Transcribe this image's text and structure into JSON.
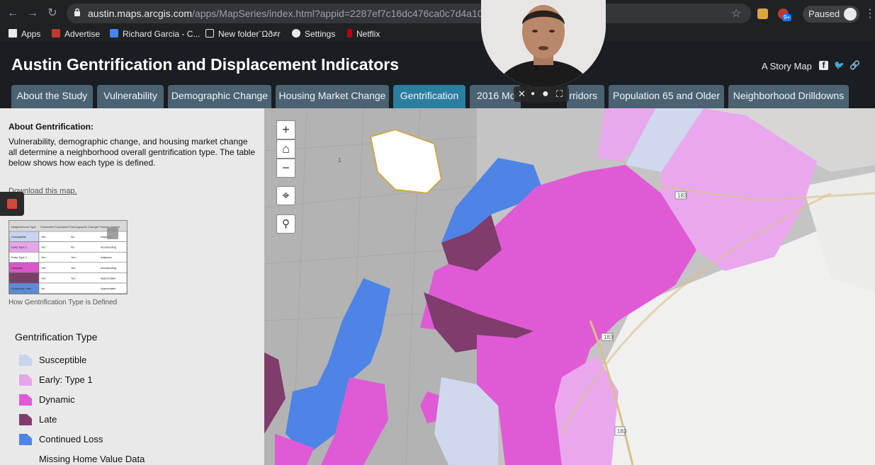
{
  "browser": {
    "url_host": "austin.maps.arcgis.com",
    "url_path": "/apps/MapSeries/index.html?appid=2287ef7c16dc476ca0c7d4a10ae690",
    "profile_status": "Paused",
    "extension_badge": "9+",
    "bookmarks": [
      {
        "label": "Apps",
        "icon": "apps-grid-icon"
      },
      {
        "label": "Advertise",
        "icon": "advertise-icon"
      },
      {
        "label": "Richard Garcia - C...",
        "icon": "calendar-icon"
      },
      {
        "label": "New folder¨Ωð≠r",
        "icon": "folder-icon"
      },
      {
        "label": "Settings",
        "icon": "gear-icon"
      },
      {
        "label": "Netflix",
        "icon": "netflix-icon"
      }
    ]
  },
  "header": {
    "title": "Austin Gentrification and Displacement Indicators",
    "story_map_label": "A Story Map"
  },
  "tabs": [
    {
      "label": "About the Study",
      "active": false
    },
    {
      "label": "Vulnerability",
      "active": false
    },
    {
      "label": "Demographic Change",
      "active": false
    },
    {
      "label": "Housing Market Change",
      "active": false
    },
    {
      "label": "Gentrification",
      "active": true
    },
    {
      "label": "2016 Mo",
      "active": false
    },
    {
      "label": "rridors",
      "active": false
    },
    {
      "label": "Population 65 and Older",
      "active": false
    },
    {
      "label": "Neighborhood Drilldowns",
      "active": false
    }
  ],
  "sidebar": {
    "heading": "About Gentrification:",
    "paragraph": "Vulnerability, demographic change, and housing market change all determine a neighborhood overall gentrification type. The table below shows how each type is defined.",
    "download_link": "Download this map.",
    "thumbnail_caption": "How Gentrification Type is Defined",
    "thumbnail_rows": [
      {
        "type": "Susceptible",
        "c1": "Yes",
        "c2": "No",
        "c3": "Adjacent",
        "color": "#c9d4ee"
      },
      {
        "type": "Early Type 1",
        "c1": "Yes",
        "c2": "No",
        "c3": "Accelerating",
        "color": "#e6a6e9"
      },
      {
        "type": "Early Type 2",
        "c1": "Yes",
        "c2": "Yes",
        "c3": "Adjacent",
        "color": "#ffffff"
      },
      {
        "type": "Dynamic",
        "c1": "Yes",
        "c2": "Yes",
        "c3": "Accelerating",
        "color": "#d957c8"
      },
      {
        "type": "",
        "c1": "Yes",
        "c2": "Yes",
        "c3": "Appreciated",
        "color": "#7a3f69"
      },
      {
        "type": "Continued Loss",
        "c1": "No",
        "c2": "",
        "c3": "Appreciated",
        "color": "#5d8ad8"
      }
    ],
    "legend_title": "Gentrification Type",
    "legend": [
      {
        "label": "Susceptible",
        "color": "#c9d4ee"
      },
      {
        "label": "Early: Type 1",
        "color": "#e6a6e9"
      },
      {
        "label": "Dynamic",
        "color": "#e05ad6"
      },
      {
        "label": "Late",
        "color": "#7f3c6c"
      },
      {
        "label": "Continued Loss",
        "color": "#4e84e6"
      },
      {
        "label": "Missing Home Value Data",
        "color": "#e9e9ea"
      }
    ]
  },
  "map": {
    "controls": [
      {
        "icon": "zoom-in-icon",
        "glyph": "+"
      },
      {
        "icon": "home-icon",
        "glyph": "⌂"
      },
      {
        "icon": "zoom-out-icon",
        "glyph": "−"
      },
      {
        "icon": "locate-icon",
        "glyph": "⌖"
      },
      {
        "icon": "search-icon",
        "glyph": "⚲"
      }
    ],
    "road_labels": [
      "183",
      "183",
      "183",
      "1"
    ]
  }
}
